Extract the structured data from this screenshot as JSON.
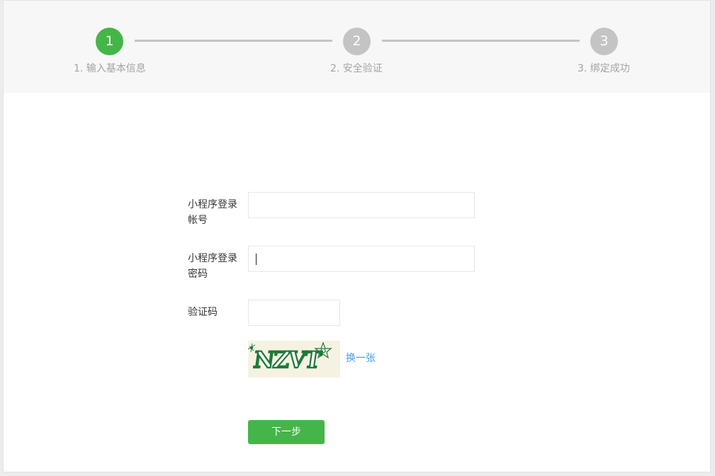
{
  "steps": [
    {
      "number": "1",
      "label": "1. 输入基本信息",
      "state": "active"
    },
    {
      "number": "2",
      "label": "2. 安全验证",
      "state": "todo"
    },
    {
      "number": "3",
      "label": "3. 绑定成功",
      "state": "todo"
    }
  ],
  "form": {
    "account_label": "小程序登录帐号",
    "account_value": "",
    "password_label": "小程序登录密码",
    "password_value": "",
    "captcha_label": "验证码",
    "captcha_value": "",
    "captcha_text": "NZVT",
    "refresh_label": "换一张",
    "next_label": "下一步"
  },
  "colors": {
    "accent": "#44b549",
    "inactive": "#c4c4c4",
    "link": "#459ae9"
  }
}
